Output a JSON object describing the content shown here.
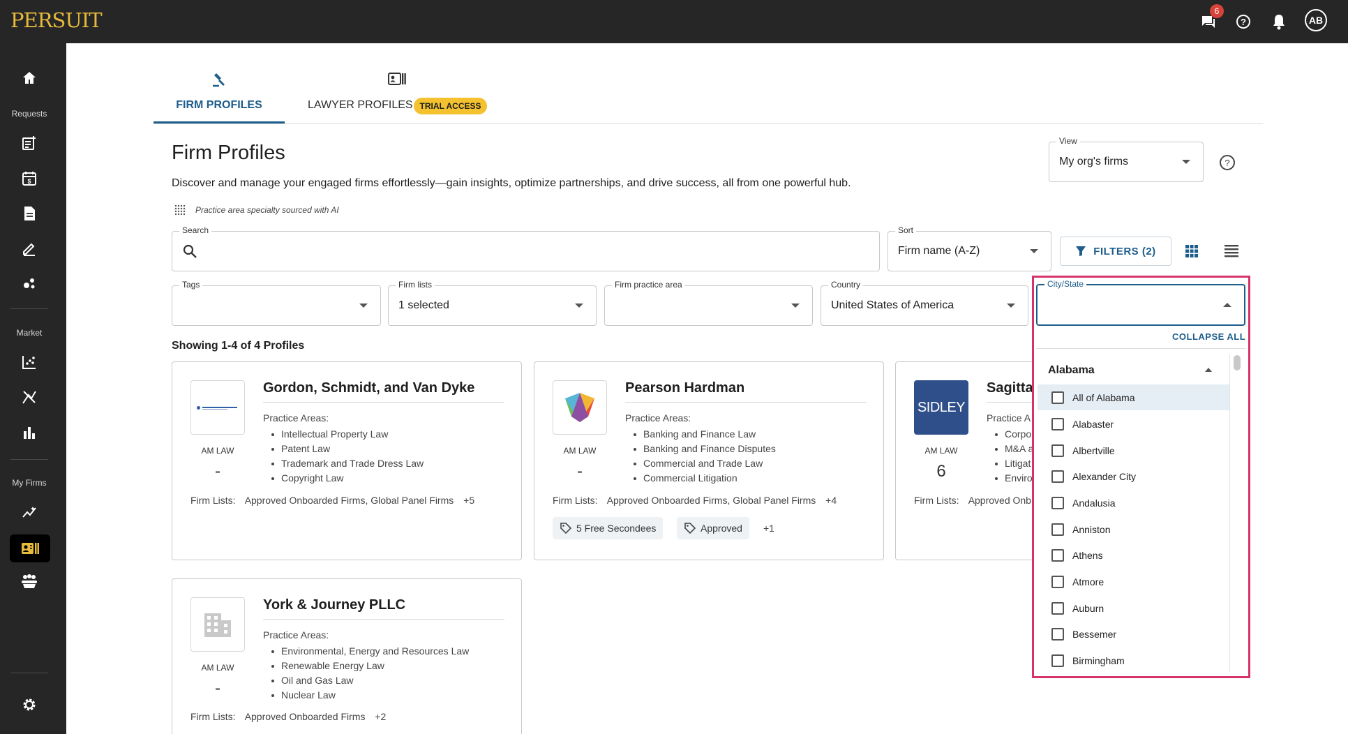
{
  "brand": {
    "logo_text": "PERSUIT"
  },
  "topbar": {
    "chat_badge": "6",
    "avatar_initials": "AB",
    "icons": [
      "chat-icon",
      "help-icon",
      "bell-icon"
    ]
  },
  "sidebar": {
    "sections": [
      "Requests",
      "Market",
      "My Firms"
    ]
  },
  "tabs": [
    {
      "label": "FIRM PROFILES",
      "active": true
    },
    {
      "label": "LAWYER PROFILES",
      "badge": "TRIAL ACCESS",
      "active": false
    }
  ],
  "page": {
    "title": "Firm Profiles",
    "description": "Discover and manage your engaged firms effortlessly—gain insights, optimize partnerships, and drive success, all from one powerful hub.",
    "ai_note": "Practice area specialty sourced with AI"
  },
  "view": {
    "label": "View",
    "value": "My org's firms"
  },
  "search": {
    "label": "Search",
    "value": ""
  },
  "sort": {
    "label": "Sort",
    "value": "Firm name (A-Z)"
  },
  "filters_button": "FILTERS (2)",
  "filters": {
    "tags": {
      "label": "Tags",
      "value": ""
    },
    "firm_lists": {
      "label": "Firm lists",
      "value": "1 selected"
    },
    "practice_area": {
      "label": "Firm practice area",
      "value": ""
    },
    "country": {
      "label": "Country",
      "value": "United States of America"
    },
    "city_state": {
      "label": "City/State",
      "value": ""
    }
  },
  "results_text": "Showing 1-4 of 4 Profiles",
  "cards": [
    {
      "name": "Gordon, Schmidt, and Van Dyke",
      "am_law_label": "AM LAW",
      "am_law_value": "-",
      "practice_label": "Practice Areas:",
      "practice_areas": [
        "Intellectual Property Law",
        "Patent Law",
        "Trademark and Trade Dress Law",
        "Copyright Law"
      ],
      "lists_label": "Firm Lists:",
      "lists": "Approved Onboarded Firms, Global Panel Firms",
      "lists_more": "+5"
    },
    {
      "name": "Pearson Hardman",
      "am_law_label": "AM LAW",
      "am_law_value": "-",
      "practice_label": "Practice Areas:",
      "practice_areas": [
        "Banking and Finance Law",
        "Banking and Finance Disputes",
        "Commercial and Trade Law",
        "Commercial Litigation"
      ],
      "lists_label": "Firm Lists:",
      "lists": "Approved Onboarded Firms, Global Panel Firms",
      "lists_more": "+4",
      "tags": [
        "5 Free Secondees",
        "Approved"
      ],
      "tags_more": "+1"
    },
    {
      "name": "Sagittar",
      "logo_text": "SIDLEY",
      "am_law_label": "AM LAW",
      "am_law_value": "6",
      "practice_label": "Practice A",
      "practice_areas": [
        "Corpo",
        "M&A a",
        "Litigat",
        "Enviro"
      ],
      "lists_label": "Firm Lists:",
      "lists": "Approved Onb"
    },
    {
      "name": "York & Journey PLLC",
      "am_law_label": "AM LAW",
      "am_law_value": "-",
      "practice_label": "Practice Areas:",
      "practice_areas": [
        "Environmental, Energy and Resources Law",
        "Renewable Energy Law",
        "Oil and Gas Law",
        "Nuclear Law"
      ],
      "lists_label": "Firm Lists:",
      "lists": "Approved Onboarded Firms",
      "lists_more": "+2"
    }
  ],
  "city_dropdown": {
    "collapse_all": "COLLAPSE ALL",
    "group": "Alabama",
    "options": [
      "All of Alabama",
      "Alabaster",
      "Albertville",
      "Alexander City",
      "Andalusia",
      "Anniston",
      "Athens",
      "Atmore",
      "Auburn",
      "Bessemer",
      "Birmingham"
    ]
  },
  "colors": {
    "accent": "#1d5d8c",
    "highlight_border": "#d6336c",
    "trial_badge": "#f3c22e",
    "logo_gold": "#e6ba3c",
    "sidebar_bg": "#262626"
  }
}
